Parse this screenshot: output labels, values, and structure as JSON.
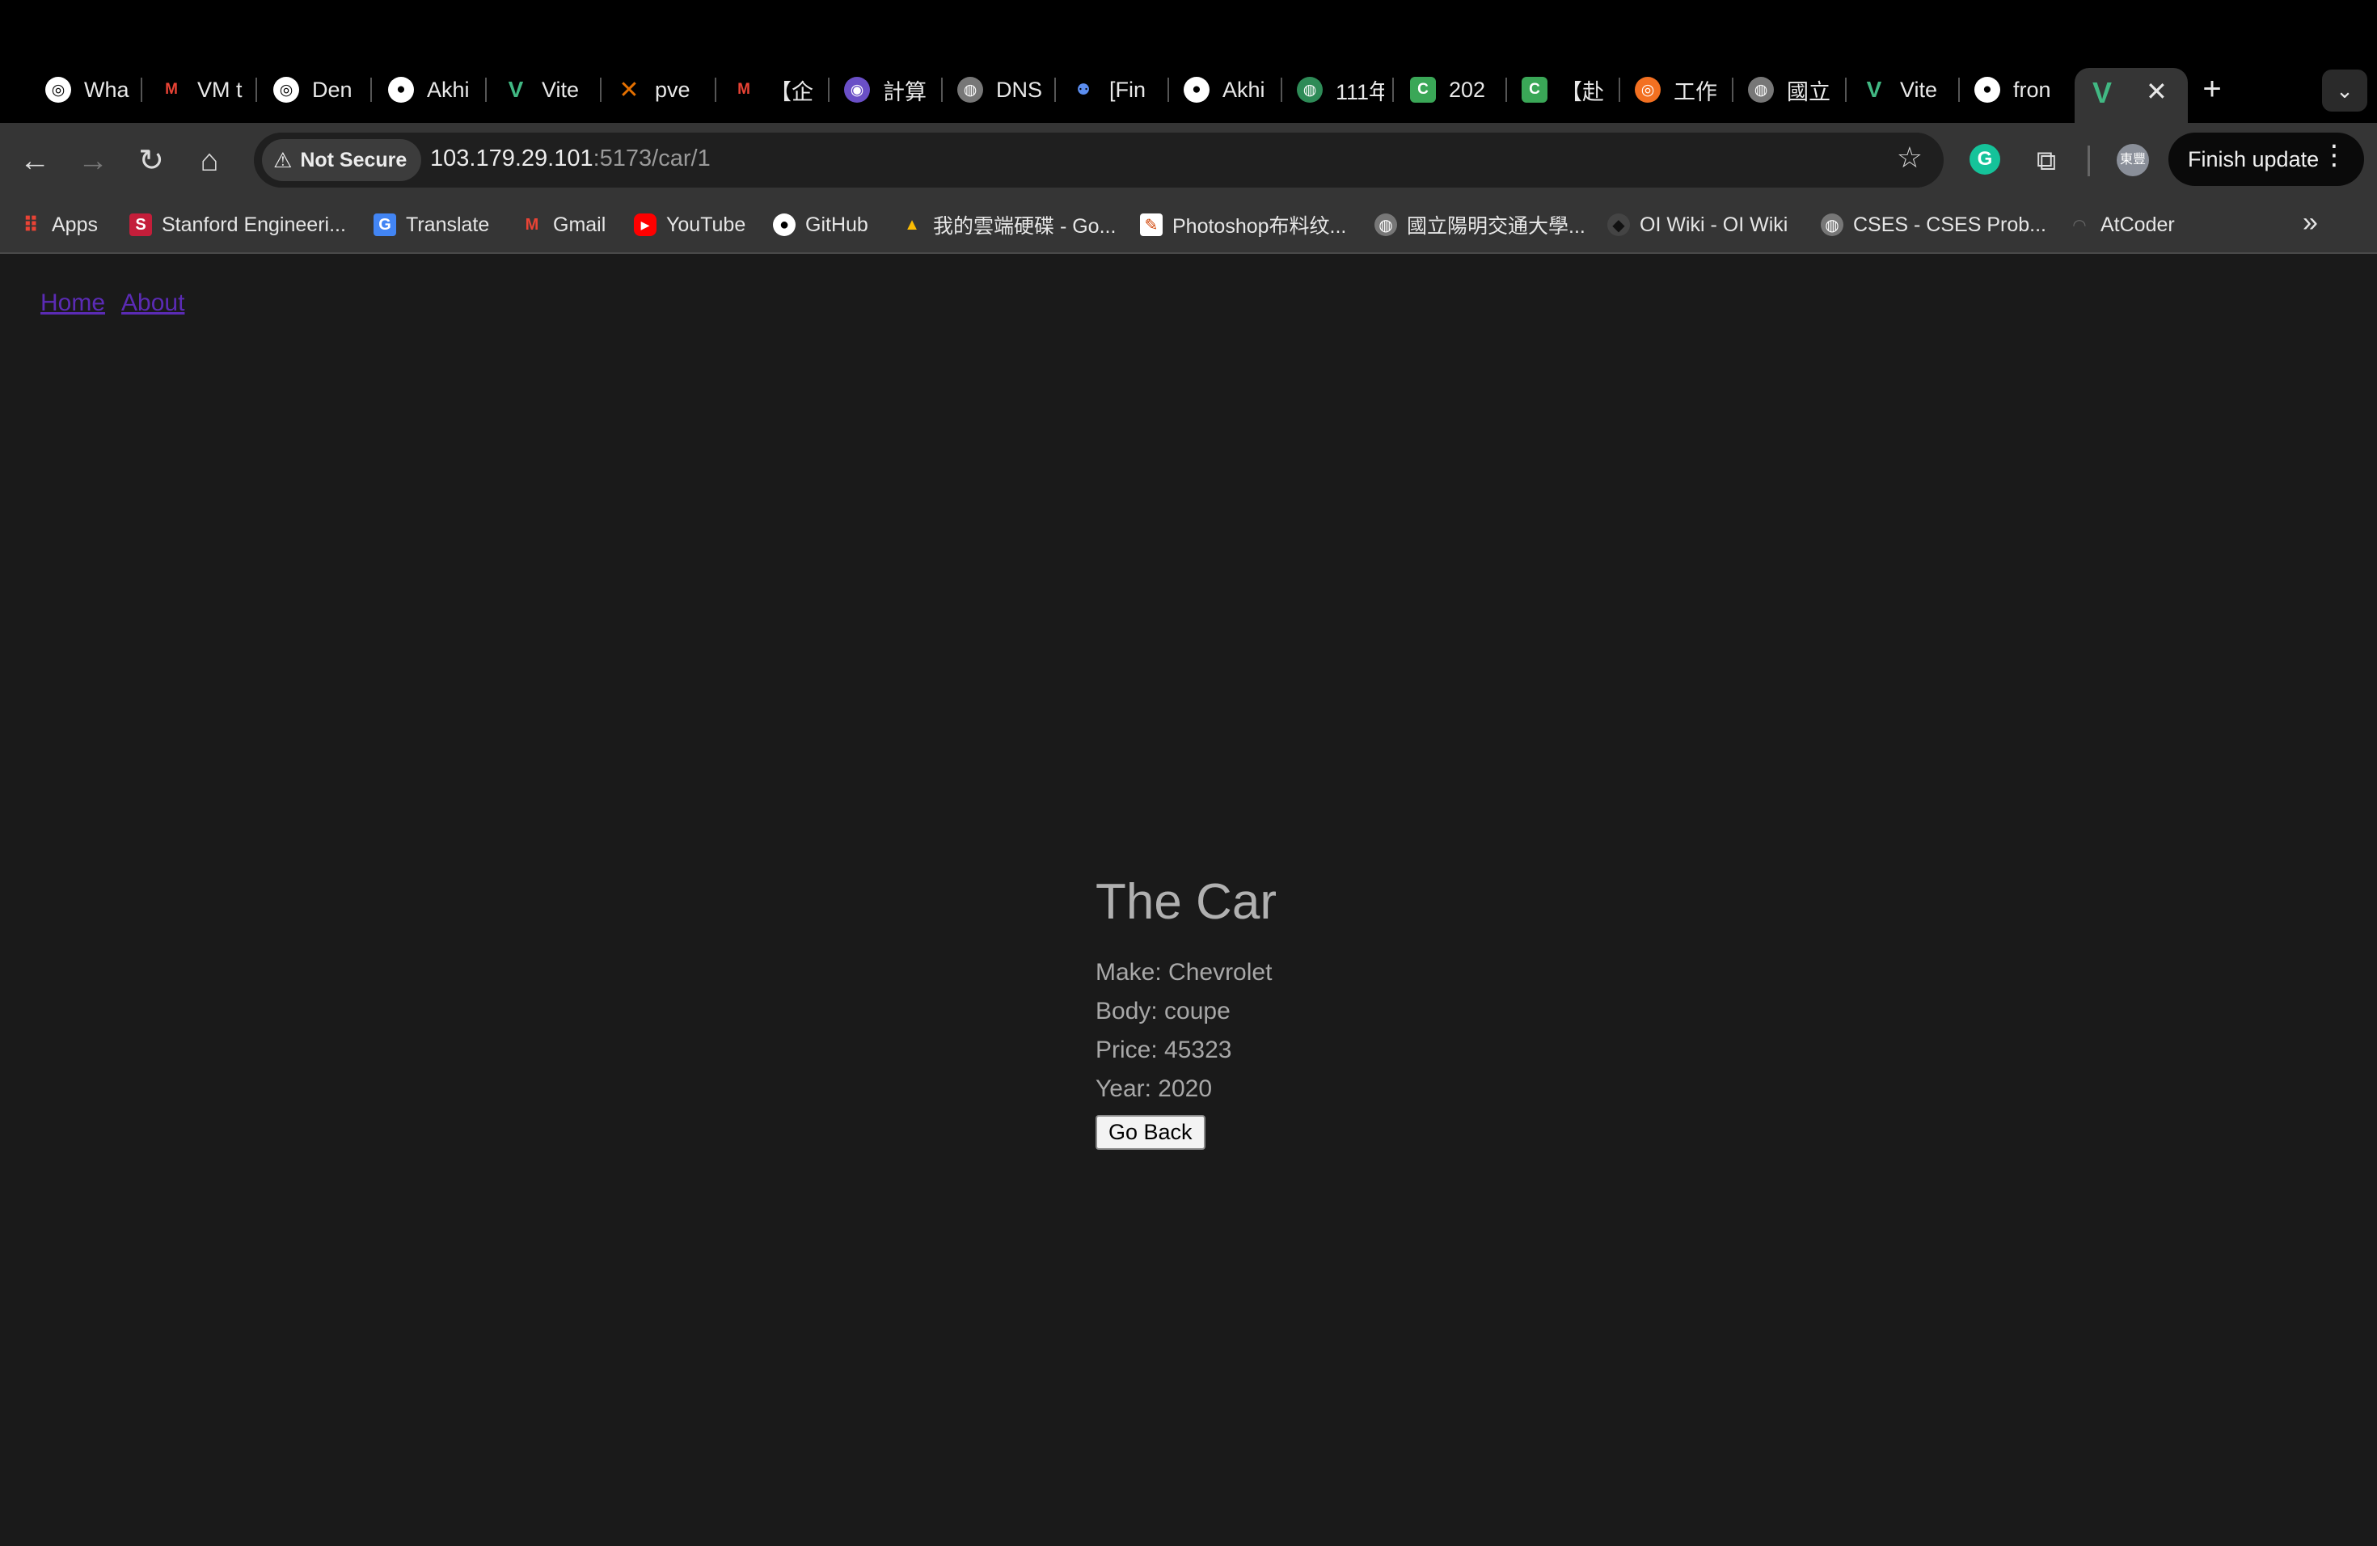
{
  "browser": {
    "tabs": [
      {
        "label": "Wha",
        "icon": "chatgpt-icon"
      },
      {
        "label": "VM t",
        "icon": "gmail-icon"
      },
      {
        "label": "Den",
        "icon": "chatgpt-icon"
      },
      {
        "label": "Akhi",
        "icon": "github-icon"
      },
      {
        "label": "Vite",
        "icon": "vue-icon"
      },
      {
        "label": "pve",
        "icon": "proxmox-icon"
      },
      {
        "label": "【企",
        "icon": "gmail-icon"
      },
      {
        "label": "計算",
        "icon": "app-icon"
      },
      {
        "label": "DNS",
        "icon": "globe-icon"
      },
      {
        "label": "[Fin",
        "icon": "people-icon"
      },
      {
        "label": "Akhi",
        "icon": "github-icon"
      },
      {
        "label": "111年",
        "icon": "globe-icon"
      },
      {
        "label": "202",
        "icon": "c-icon"
      },
      {
        "label": "【赴",
        "icon": "c-icon"
      },
      {
        "label": "工作",
        "icon": "app-icon"
      },
      {
        "label": "國立",
        "icon": "globe-icon"
      },
      {
        "label": "Vite",
        "icon": "vue-icon"
      },
      {
        "label": "fron",
        "icon": "github-icon"
      }
    ],
    "active_tab": {
      "icon": "vue-icon",
      "close": "✕"
    },
    "new_tab": "+",
    "security_label": "Not Secure",
    "url_host": "103.179.29.101",
    "url_rest": ":5173/car/1",
    "avatar_text": "東豐",
    "update_button": "Finish update",
    "bookmarks": [
      {
        "label": "Apps",
        "icon": "apps-grid-icon"
      },
      {
        "label": "Stanford Engineeri...",
        "icon": "stanford-icon"
      },
      {
        "label": "Translate",
        "icon": "translate-icon"
      },
      {
        "label": "Gmail",
        "icon": "gmail-icon"
      },
      {
        "label": "YouTube",
        "icon": "youtube-icon"
      },
      {
        "label": "GitHub",
        "icon": "github-icon"
      },
      {
        "label": "我的雲端硬碟 - Go...",
        "icon": "drive-icon"
      },
      {
        "label": "Photoshop布料纹...",
        "icon": "photoshop-icon"
      },
      {
        "label": "國立陽明交通大學...",
        "icon": "globe-icon"
      },
      {
        "label": "OI Wiki - OI Wiki",
        "icon": "oiwiki-icon"
      },
      {
        "label": "CSES - CSES Prob...",
        "icon": "globe-icon"
      },
      {
        "label": "AtCoder",
        "icon": "atcoder-icon"
      }
    ]
  },
  "page": {
    "nav": {
      "home": "Home",
      "about": "About"
    },
    "car": {
      "title": "The Car",
      "make": "Make: Chevrolet",
      "body": "Body: coupe",
      "price": "Price: 45323",
      "year": "Year: 2020",
      "back_button": "Go Back"
    }
  },
  "colors": {
    "page_bg": "#1a1a1a",
    "tabstrip_bg": "#000000",
    "toolbar_bg": "#353535",
    "link": "#5b2bb5",
    "vue_green": "#41b883"
  }
}
